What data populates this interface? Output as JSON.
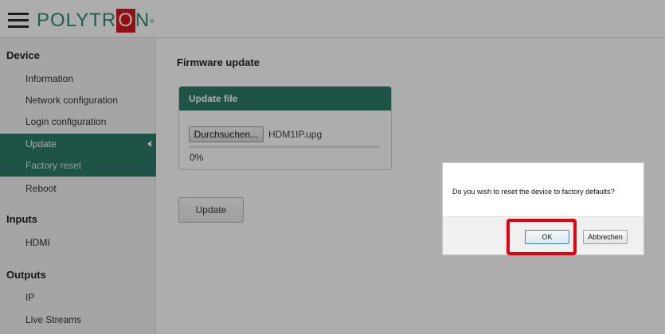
{
  "header": {
    "logo_prefix": "POLYTR",
    "logo_boxed": "O",
    "logo_suffix": "N",
    "logo_mark": "®",
    "menu_icon": "hamburger-icon"
  },
  "sidebar": {
    "sections": [
      {
        "title": "Device",
        "items": [
          {
            "label": "Information"
          },
          {
            "label": "Network configuration"
          },
          {
            "label": "Login configuration"
          },
          {
            "label": "Update",
            "state": "active"
          },
          {
            "label": "Factory reset",
            "state": "active-sub"
          },
          {
            "label": "Reboot"
          }
        ]
      },
      {
        "title": "Inputs",
        "items": [
          {
            "label": "HDMI"
          }
        ]
      },
      {
        "title": "Outputs",
        "items": [
          {
            "label": "IP"
          },
          {
            "label": "Live Streams"
          }
        ]
      }
    ]
  },
  "main": {
    "title": "Firmware update",
    "panel": {
      "header": "Update file",
      "browse_label": "Durchsuchen...",
      "file_name": "HDM1IP.upg",
      "progress_value": 0,
      "progress_text": "0%"
    },
    "update_label": "Update"
  },
  "dialog": {
    "message": "Do you wish to reset the device to factory defaults?",
    "ok_label": "OK",
    "cancel_label": "Abbrechen"
  },
  "colors": {
    "accent": "#2d7d6a",
    "logo_red": "#d7191f",
    "highlight": "#e3000f"
  }
}
